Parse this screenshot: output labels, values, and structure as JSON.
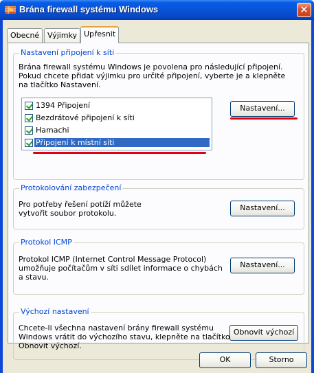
{
  "window": {
    "title": "Brána firewall systému Windows",
    "close_label": "✕"
  },
  "tabs": [
    {
      "label": "Obecné",
      "active": false
    },
    {
      "label": "Výjimky",
      "active": false
    },
    {
      "label": "Upřesnit",
      "active": true
    }
  ],
  "connections_group": {
    "title": "Nastavení připojení k síti",
    "description": "Brána firewall systému Windows je povolena pro následující připojení. Pokud chcete přidat výjimku pro určité připojení, vyberte je a klepněte na tlačítko Nastavení.",
    "items": [
      {
        "label": "1394 Připojení",
        "checked": true,
        "selected": false
      },
      {
        "label": "Bezdrátové připojení k síti",
        "checked": true,
        "selected": false
      },
      {
        "label": "Hamachi",
        "checked": true,
        "selected": false
      },
      {
        "label": "Připojení k místní síti",
        "checked": true,
        "selected": true
      }
    ],
    "button_label": "Nastavení..."
  },
  "logging_group": {
    "title": "Protokolování zabezpečení",
    "description": "Pro potřeby řešení potíží můžete vytvořit soubor protokolu.",
    "button_label": "Nastavení..."
  },
  "icmp_group": {
    "title": "Protokol ICMP",
    "description": "Protokol ICMP (Internet Control Message Protocol) umožňuje počítačům v síti sdílet informace o chybách a stavu.",
    "button_label": "Nastavení..."
  },
  "defaults_group": {
    "title": "Výchozí nastavení",
    "description": "Chcete-li všechna nastavení brány firewall systému Windows vrátit do výchozího stavu, klepněte na tlačítko Obnovit výchozí.",
    "button_label": "Obnovit výchozí"
  },
  "footer": {
    "ok_label": "OK",
    "cancel_label": "Storno"
  },
  "colors": {
    "titlebar": "#0653d6",
    "group_title": "#0046d5",
    "selection": "#316ac5",
    "annotation_red": "#e00010"
  }
}
